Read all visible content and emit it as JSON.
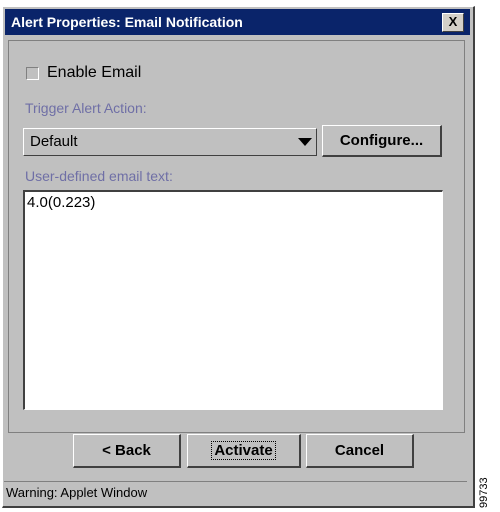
{
  "window": {
    "title": "Alert Properties: Email Notification",
    "close_glyph": "X"
  },
  "form": {
    "enable_email_label": "Enable Email",
    "enable_email_checked": false,
    "trigger_label": "Trigger Alert Action:",
    "trigger_value": "Default",
    "configure_label": "Configure...",
    "email_text_label": "User-defined email text:",
    "email_text_value": "4.0(0.223)"
  },
  "footer": {
    "back_label": "< Back",
    "activate_label": "Activate",
    "cancel_label": "Cancel"
  },
  "status": {
    "text": "Warning: Applet Window"
  },
  "figure_id": "99733",
  "colors": {
    "titlebar": "#0a246a",
    "section_label": "#6f6fa6",
    "window_bg": "#c0c0c0"
  },
  "icons": {
    "dropdown": "chevron-down-icon",
    "close": "close-icon"
  }
}
